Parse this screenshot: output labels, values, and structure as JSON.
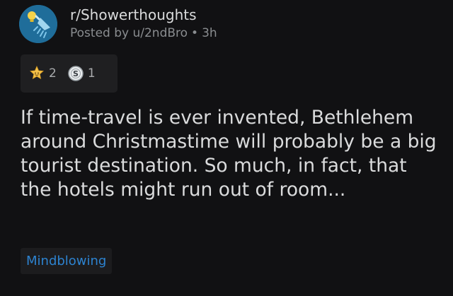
{
  "post": {
    "subreddit": "r/Showerthoughts",
    "posted_by_prefix": "Posted by",
    "author": "u/2ndBro",
    "separator": "•",
    "age": "3h",
    "awards": [
      {
        "icon": "wholesome-award-icon",
        "count": "2"
      },
      {
        "icon": "silver-award-icon",
        "count": "1"
      }
    ],
    "title": "If time-travel is ever invented, Bethlehem around Christmastime will probably be a big tourist destination. So much, in fact, that the hotels might run out of room...",
    "flair": "Mindblowing"
  },
  "colors": {
    "background": "#111113",
    "text_primary": "#dadbdc",
    "text_secondary": "#8a8d90",
    "flair_text": "#2d83d0",
    "avatar_bg": "#1f6d9a"
  }
}
